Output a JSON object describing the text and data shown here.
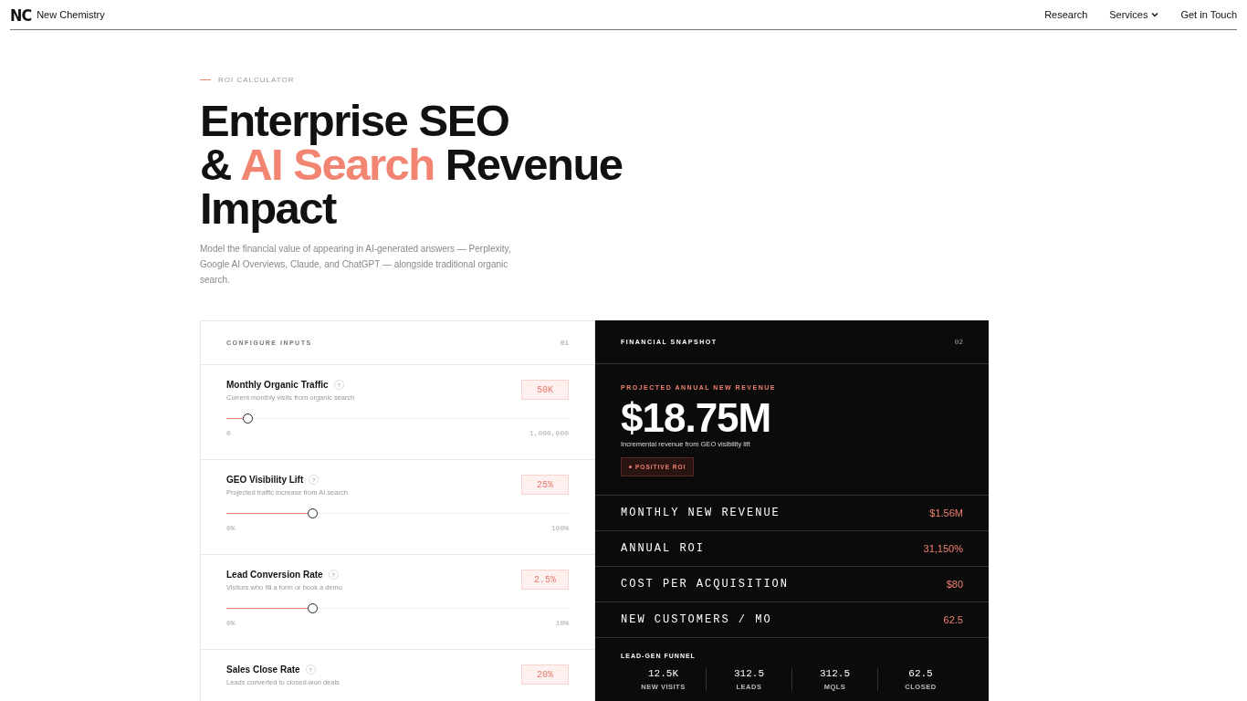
{
  "nav": {
    "logo": "NC",
    "brand": "New Chemistry",
    "links": [
      {
        "label": "Research",
        "dropdown": false
      },
      {
        "label": "Services",
        "dropdown": true
      },
      {
        "label": "Get in Touch",
        "dropdown": false
      }
    ]
  },
  "hero": {
    "eyebrow": "ROI CALCULATOR",
    "headline": [
      [
        {
          "text": "Enterprise SEO",
          "accent": false
        }
      ],
      [
        {
          "text": "& ",
          "accent": false
        },
        {
          "text": "AI Search",
          "accent": true
        },
        {
          "text": " Revenue",
          "accent": false
        }
      ],
      [
        {
          "text": "Impact",
          "accent": false
        }
      ]
    ],
    "description": "Model the financial value of appearing in AI-generated answers — Perplexity, Google AI Overviews, Claude, and ChatGPT — alongside traditional organic search."
  },
  "inputs": {
    "title": "CONFIGURE INPUTS",
    "number": "01",
    "fields": [
      {
        "label": "Monthly Organic Traffic",
        "help": "?",
        "hint": "Current monthly visits from organic search",
        "value": "50K",
        "level": 0.06,
        "min": "0",
        "max": "1,000,000"
      },
      {
        "label": "GEO Visibility Lift",
        "help": "?",
        "hint": "Projected traffic increase from AI search",
        "value": "25%",
        "level": 0.25,
        "min": "0%",
        "max": "100%"
      },
      {
        "label": "Lead Conversion Rate",
        "help": "?",
        "hint": "Visitors who fill a form or book a demo",
        "value": "2.5%",
        "level": 0.25,
        "min": "0%",
        "max": "10%"
      },
      {
        "label": "Sales Close Rate",
        "help": "?",
        "hint": "Leads converted to closed-won deals",
        "value": "20%"
      }
    ]
  },
  "snapshot": {
    "title": "FINANCIAL SNAPSHOT",
    "number": "02",
    "kicker": "PROJECTED ANNUAL NEW REVENUE",
    "amount": "$18.75M",
    "caption": "Incremental revenue from GEO visibility lift",
    "badge": "POSITIVE ROI",
    "metrics": [
      {
        "label": "MONTHLY NEW REVENUE",
        "value": "$1.56M"
      },
      {
        "label": "ANNUAL ROI",
        "value": "31,150%"
      },
      {
        "label": "COST PER ACQUISITION",
        "value": "$80"
      },
      {
        "label": "NEW CUSTOMERS / MO",
        "value": "62.5"
      }
    ],
    "funnel": {
      "title": "LEAD-GEN FUNNEL",
      "steps": [
        {
          "value": "12.5K",
          "label": "NEW VISITS"
        },
        {
          "value": "312.5",
          "label": "LEADS"
        },
        {
          "value": "312.5",
          "label": "MQLS"
        },
        {
          "value": "62.5",
          "label": "CLOSED"
        }
      ]
    }
  }
}
